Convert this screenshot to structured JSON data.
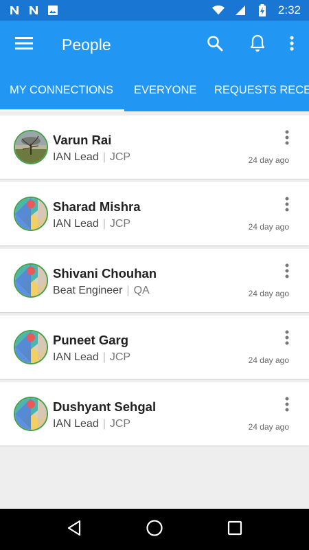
{
  "status_bar": {
    "time": "2:32",
    "left_icons": [
      "n-notification-icon",
      "n-notification-icon",
      "image-icon"
    ],
    "right_icons": [
      "wifi-icon",
      "signal-icon",
      "battery-charging-icon"
    ]
  },
  "app_bar": {
    "title": "People",
    "color": "#2196f3"
  },
  "tabs": [
    {
      "label": "MY CONNECTIONS",
      "selected": true
    },
    {
      "label": "EVERYONE",
      "selected": false
    },
    {
      "label": "REQUESTS RECEI",
      "selected": false
    }
  ],
  "connections": [
    {
      "name": "Varun Rai",
      "role": "IAN Lead",
      "separator": "|",
      "org": "JCP",
      "time": "24 day ago",
      "avatar": "tree-photo"
    },
    {
      "name": "Sharad Mishra",
      "role": "IAN Lead",
      "separator": "|",
      "org": "JCP",
      "time": "24 day ago",
      "avatar": "default-avatar"
    },
    {
      "name": "Shivani Chouhan",
      "role": "Beat Engineer",
      "separator": "|",
      "org": "QA",
      "time": "24 day ago",
      "avatar": "default-avatar"
    },
    {
      "name": "Puneet Garg",
      "role": "IAN Lead",
      "separator": "|",
      "org": "JCP",
      "time": "24 day ago",
      "avatar": "default-avatar"
    },
    {
      "name": "Dushyant Sehgal",
      "role": "IAN Lead",
      "separator": "|",
      "org": "JCP",
      "time": "24 day ago",
      "avatar": "default-avatar"
    }
  ]
}
